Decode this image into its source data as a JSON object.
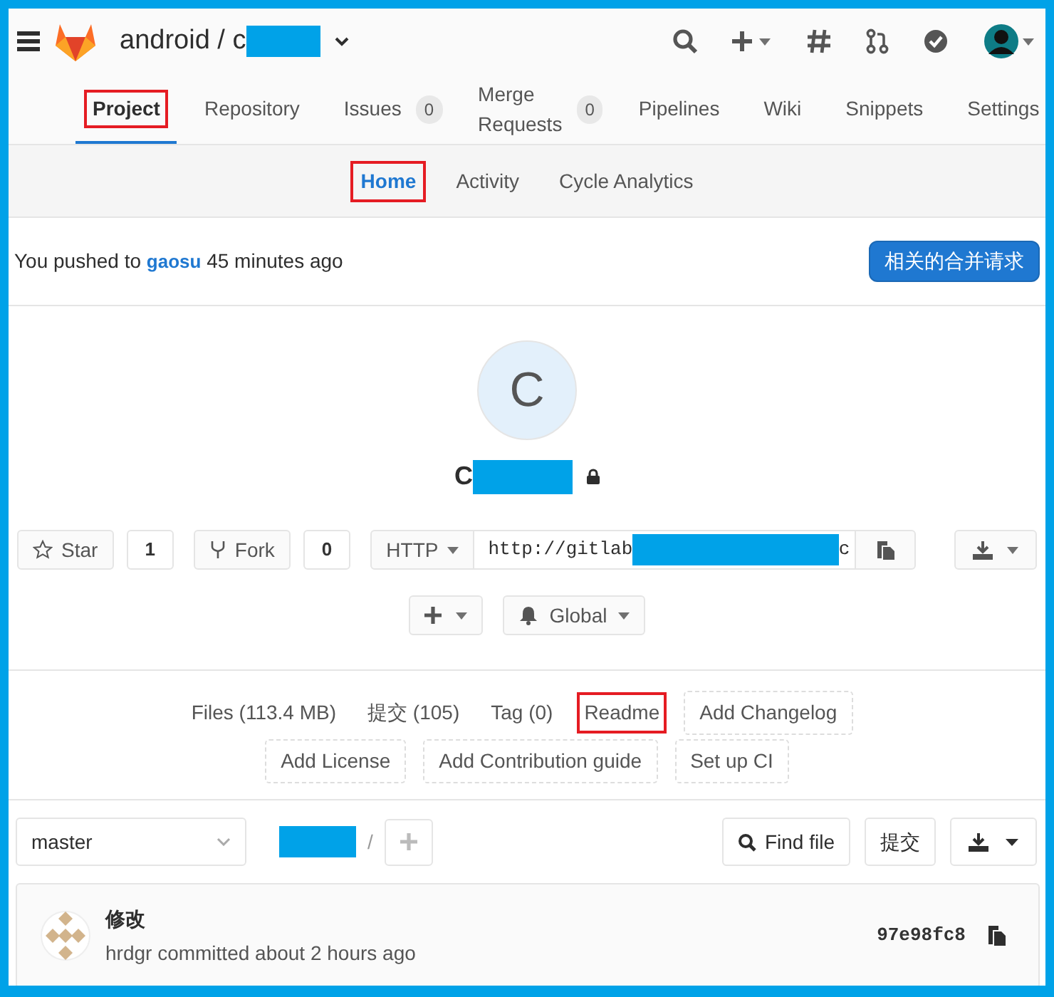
{
  "header": {
    "breadcrumb": "android / c",
    "redacted": true
  },
  "nav_tabs": [
    {
      "label": "Project",
      "selected": true,
      "annotated": true
    },
    {
      "label": "Repository",
      "selected": false,
      "annotated": false
    },
    {
      "label": "Issues",
      "count": "0",
      "selected": false,
      "annotated": false
    },
    {
      "label": "Merge Requests",
      "count": "0",
      "selected": false,
      "annotated": false
    },
    {
      "label": "Pipelines",
      "selected": false,
      "annotated": false
    },
    {
      "label": "Wiki",
      "selected": false,
      "annotated": false
    },
    {
      "label": "Snippets",
      "selected": false,
      "annotated": false
    },
    {
      "label": "Settings",
      "selected": false,
      "annotated": false
    }
  ],
  "sub_tabs": [
    {
      "label": "Home",
      "selected": true,
      "annotated": true
    },
    {
      "label": "Activity",
      "selected": false,
      "annotated": false
    },
    {
      "label": "Cycle Analytics",
      "selected": false,
      "annotated": false
    }
  ],
  "push_notice": {
    "before": "You pushed to",
    "branch": "gaosu",
    "after": "45 minutes ago",
    "button": "相关的合并请求"
  },
  "project": {
    "avatar_letter": "C",
    "name": "C",
    "redacted": true,
    "private": true
  },
  "star": {
    "label": "Star",
    "count": "1"
  },
  "fork": {
    "label": "Fork",
    "count": "0"
  },
  "clone": {
    "protocol": "HTTP",
    "url_start": "http://gitlab",
    "url_end": "c",
    "redacted": true
  },
  "notification": {
    "label": "Global"
  },
  "stats": [
    {
      "label": "Files (113.4 MB)",
      "kind": "link",
      "annotated": false
    },
    {
      "label": "提交 (105)",
      "kind": "link",
      "annotated": false
    },
    {
      "label": "Tag (0)",
      "kind": "link",
      "annotated": false
    },
    {
      "label": "Readme",
      "kind": "link",
      "annotated": true
    },
    {
      "label": "Add Changelog",
      "kind": "dashed",
      "annotated": false
    },
    {
      "label": "Add License",
      "kind": "dashed",
      "annotated": false
    },
    {
      "label": "Add Contribution guide",
      "kind": "dashed",
      "annotated": false
    },
    {
      "label": "Set up CI",
      "kind": "dashed",
      "annotated": false
    }
  ],
  "tree": {
    "branch": "master",
    "path_redacted": true,
    "separator": "/",
    "find_file": "Find file",
    "commit_button": "提交"
  },
  "last_commit": {
    "title": "修改",
    "meta": "hrdgr committed about 2 hours ago",
    "sha": "97e98fc8"
  }
}
